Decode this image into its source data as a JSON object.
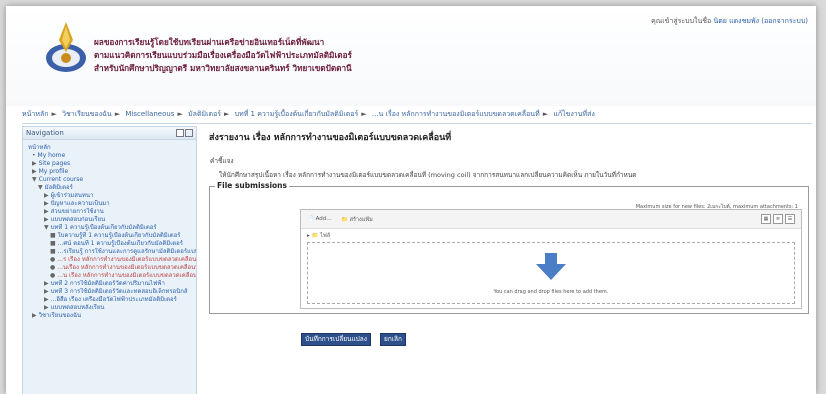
{
  "header": {
    "login_text": "คุณเข้าสู่ระบบในชื่อ",
    "login_user": "นิตย แดงชมพัง (ออกจากระบบ)",
    "title_lines": [
      "ผลของการเรียนรู้โดยใช้บทเรียนผ่านเครือข่ายอินเทอร์เน็ตที่พัฒนา",
      "ตามแนวคิดการเรียนแบบร่วมมือเรื่องเครื่องมือวัดไฟฟ้าประเภทมัลติมิเตอร์",
      "สำหรับนักศึกษาปริญญาตรี มหาวิทยาลัยสงขลานครินทร์ วิทยาเขตปัตตานี"
    ]
  },
  "breadcrumb": [
    "หน้าหลัก",
    "วิชาเรียนของฉัน",
    "Miscellaneous",
    "มัลติมิเตอร์",
    "บทที่ 1 ความรู้เบื้องต้นเกี่ยวกับมัลติมิเตอร์",
    "...น เรื่อง หลักการทำงานของมิเตอร์แบบขดลวดเคลื่อนที่",
    "แก้ไขงานที่ส่ง"
  ],
  "navigation": {
    "title": "Navigation",
    "items": [
      {
        "text": "หน้าหลัก",
        "indent": 0,
        "marker": ""
      },
      {
        "text": "My home",
        "indent": 1,
        "marker": "•"
      },
      {
        "text": "Site pages",
        "indent": 1,
        "marker": "▶"
      },
      {
        "text": "My profile",
        "indent": 1,
        "marker": "▶"
      },
      {
        "text": "Current course",
        "indent": 1,
        "marker": "▼"
      },
      {
        "text": "มัลติมิเตอร์",
        "indent": 2,
        "marker": "▼"
      },
      {
        "text": "ผู้เข้าร่วมสนทนา",
        "indent": 3,
        "marker": "▶"
      },
      {
        "text": "ปัญหาและความเป็นมา",
        "indent": 3,
        "marker": "▶"
      },
      {
        "text": "ส่วนขยายการใช้งาน",
        "indent": 3,
        "marker": "▶"
      },
      {
        "text": "แบบทดสอบก่อนเรียน",
        "indent": 3,
        "marker": "▶"
      },
      {
        "text": "บทที่ 1 ความรู้เบื้องต้นเกี่ยวกับมัลติมิเตอร์",
        "indent": 3,
        "marker": "▼"
      },
      {
        "text": "ใบความรู้ที่ 1 ความรู้เบื้องต้นเกี่ยวกับมัลติมิเตอร์",
        "indent": 4,
        "marker": "■"
      },
      {
        "text": "...ศน์ ตอนที่ 1 ความรู้เบื้องต้นเกี่ยวกับมัลติมิเตอร์",
        "indent": 4,
        "marker": "■"
      },
      {
        "text": "...รเรียนรู้ การใช้งานและการดูแลรักษามัลติมิเตอร์แบบเข็ม",
        "indent": 4,
        "marker": "■"
      },
      {
        "text": "...ร เรื่อง หลักการทำงานของมิเตอร์แบบขดลวดเคลื่อนที่",
        "indent": 4,
        "marker": "●"
      },
      {
        "text": "...นเรื่อง หลักการทำงานของมิเตอร์แบบขดลวดเคลื่อนที่",
        "indent": 4,
        "marker": "●"
      },
      {
        "text": "...น เรื่อง หลักการทำงานของมิเตอร์แบบขดลวดเคลื่อนที่",
        "indent": 4,
        "marker": "●"
      },
      {
        "text": "บทที่ 2 การใช้มัลติมิเตอร์วัดค่าปริมาณไฟฟ้า",
        "indent": 3,
        "marker": "▶"
      },
      {
        "text": "บทที่ 3 การใช้มัลติมิเตอร์วัดและทดสอบอิเล็กทรอนิกส์",
        "indent": 3,
        "marker": "▶"
      },
      {
        "text": "...อิสือ เรื่อง เครื่องมือวัดไฟฟ้าประเภทมัลติมิเตอร์",
        "indent": 3,
        "marker": "▶"
      },
      {
        "text": "แบบทดสอบหลังเรียน",
        "indent": 3,
        "marker": "▶"
      },
      {
        "text": "วิชาเรียนของฉัน",
        "indent": 1,
        "marker": "▶"
      }
    ]
  },
  "main": {
    "title": "ส่งรายงาน เรื่อง หลักการทำงานของมิเตอร์แบบขดลวดเคลื่อนที่",
    "desc_label": "คำชี้แจง",
    "description": "ให้นักศึกษาสรุปเนื้อหา เรื่อง หลักการทำงานของมิเตอร์แบบขดลวดเคลื่อนที่ (moving coil) จากการสนทนาแลกเปลี่ยนความคิดเห็น ภายในวันที่กำหนด",
    "fieldset_legend": "File submissions",
    "maxsize": "Maximum size for new files: 2เมกะไบต์, maximum attachments: 1",
    "add_label": "Add...",
    "mkdir_label": "สร้างแฟ้ม",
    "path_label": "ไฟล์",
    "drop_text": "You can drag and drop files here to add them.",
    "save_label": "บันทึกการเปลี่ยนแปลง",
    "cancel_label": "ยกเลิก"
  },
  "colors": {
    "title": "#6a1c3b",
    "link": "#2a5ea8",
    "button": "#2d4f8a",
    "arrow": "#4a7fc8"
  }
}
